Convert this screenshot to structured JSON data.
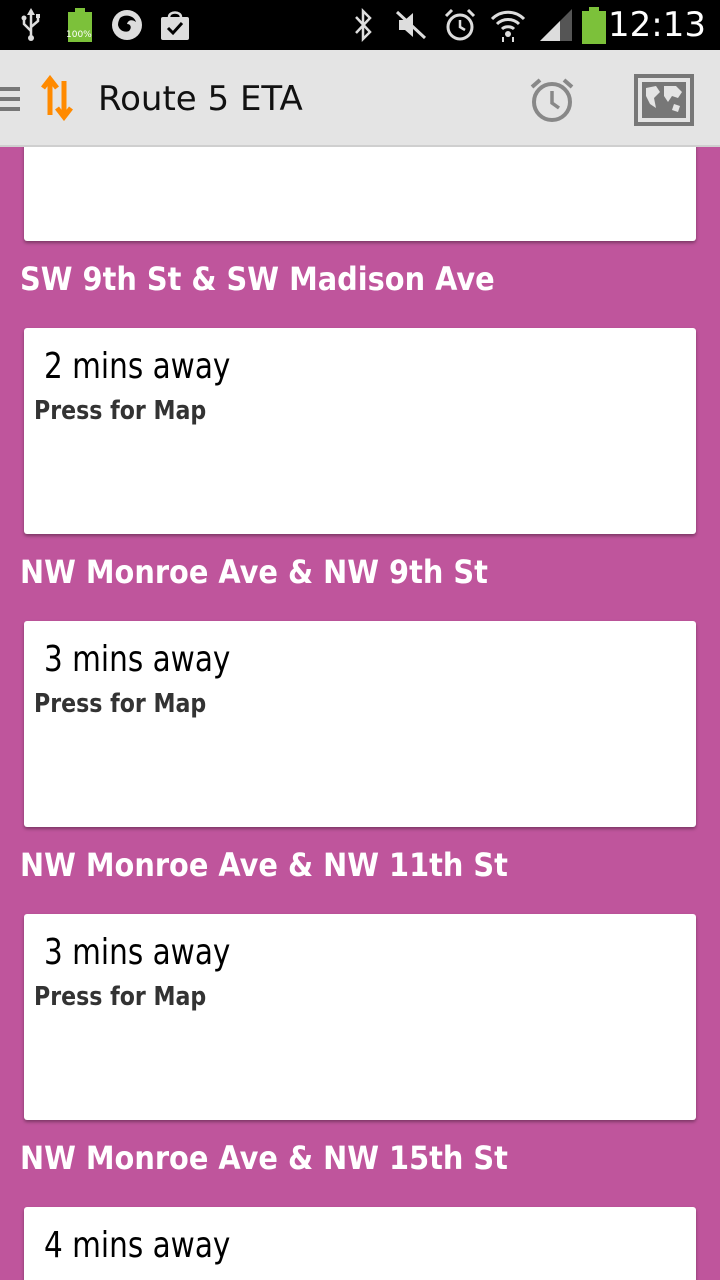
{
  "status_bar": {
    "time": "12:13",
    "battery_badge": "100%",
    "icons": [
      "usb-icon",
      "battery-full-icon",
      "firefox-icon",
      "shopping-bag-icon",
      "bluetooth-icon",
      "mute-icon",
      "alarm-icon",
      "wifi-icon",
      "signal-icon",
      "battery-icon"
    ]
  },
  "action_bar": {
    "title": "Route 5 ETA",
    "icons": [
      "menu-icon",
      "route-arrows-icon",
      "alarm-clock-icon",
      "map-icon"
    ]
  },
  "colors": {
    "background": "#bf559c",
    "card": "#ffffff",
    "action_bar": "#e4e4e4",
    "app_icon": "#ff8a00"
  },
  "stops": [
    {
      "name": "",
      "eta": "",
      "hint": ""
    },
    {
      "name": "SW 9th St & SW Madison Ave",
      "eta": "2 mins away",
      "hint": "Press for Map"
    },
    {
      "name": "NW Monroe Ave & NW 9th St",
      "eta": "3 mins away",
      "hint": "Press for Map"
    },
    {
      "name": "NW Monroe Ave & NW 11th St",
      "eta": "3 mins away",
      "hint": "Press for Map"
    },
    {
      "name": "NW Monroe Ave & NW 15th St",
      "eta": "4 mins away",
      "hint": ""
    }
  ]
}
